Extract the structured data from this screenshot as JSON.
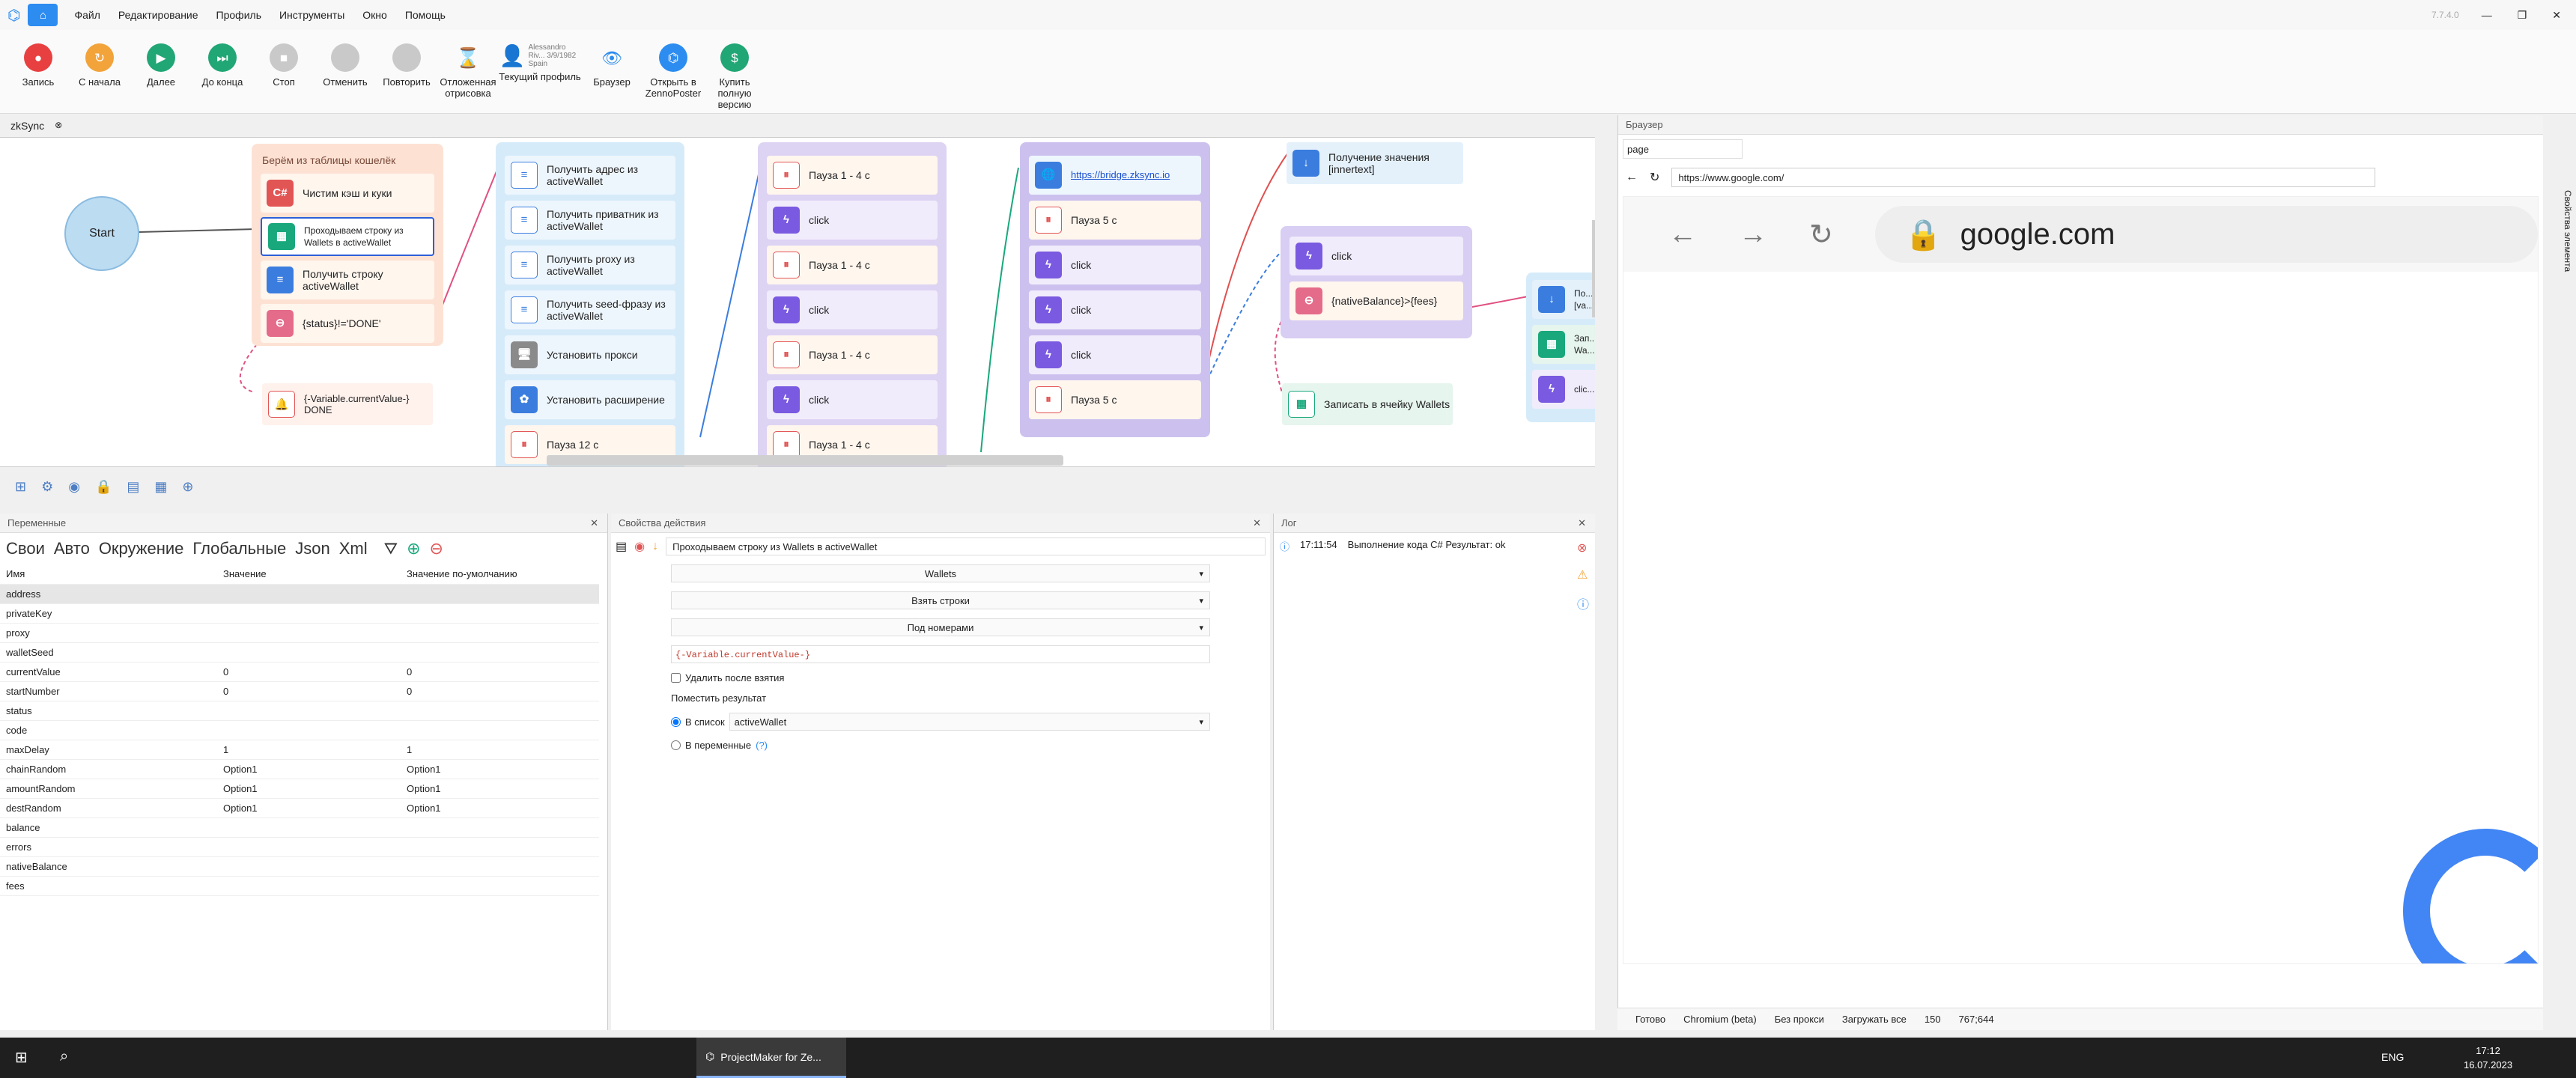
{
  "menu": {
    "items": [
      "Файл",
      "Редактирование",
      "Профиль",
      "Инструменты",
      "Окно",
      "Помощь"
    ],
    "version": "7.7.4.0"
  },
  "toolbar": {
    "buttons": [
      {
        "label": "Запись",
        "color": "#e84040"
      },
      {
        "label": "С начала",
        "color": "#f2a33a"
      },
      {
        "label": "Далее",
        "color": "#21a675"
      },
      {
        "label": "До конца",
        "color": "#21a675"
      },
      {
        "label": "Стоп",
        "color": ""
      },
      {
        "label": "Отменить",
        "color": ""
      },
      {
        "label": "Повторить",
        "color": ""
      },
      {
        "label": "Отложенная отрисовка",
        "color": ""
      },
      {
        "label": "Текущий профиль",
        "color": ""
      },
      {
        "label": "Браузер",
        "color": ""
      },
      {
        "label": "Открыть в ZennoPoster",
        "color": "#2d8cf0"
      },
      {
        "label": "Купить полную версию",
        "color": "#21a675"
      }
    ],
    "profile_text": "Alessandro Riv... 3/9/1982 Spain"
  },
  "project_tab": "zkSync",
  "canvas": {
    "start": "Start",
    "group1": {
      "title": "Берём из таблицы кошелёк",
      "nodes": [
        "Чистим кэш и куки",
        "Проходываем строку из Wallets в activeWallet",
        "Получить строку activeWallet",
        "{status}!='DONE'"
      ]
    },
    "floating": "{-Variable.currentValue-} DONE",
    "group2": {
      "nodes": [
        "Получить адрес из activeWallet",
        "Получить приватник из activeWallet",
        "Получить proxy из activeWallet",
        "Получить seed-фразу из activeWallet",
        "Установить прокси",
        "Установить расширение",
        "Пауза 12 с"
      ]
    },
    "group3": {
      "nodes": [
        "Пауза 1 - 4 с",
        "click",
        "Пауза 1 - 4 с",
        "click",
        "Пауза 1 - 4 с",
        "click",
        "Пауза 1 - 4 с"
      ]
    },
    "group4": {
      "nodes": [
        "https://bridge.zksync.io",
        "Пауза 5 с",
        "click",
        "click",
        "click",
        "Пауза 5 с"
      ]
    },
    "inner": "Получение значения [innertext]",
    "group5": {
      "nodes": [
        "click",
        "{nativeBalance}>{fees}"
      ]
    },
    "write": "Записать в ячейку Wallets",
    "group6": {
      "nodes": [
        "По... [va...",
        "Зап... Wa...",
        "clic..."
      ]
    }
  },
  "variables": {
    "title": "Переменные",
    "tabs": [
      "Свои",
      "Авто",
      "Окружение",
      "Глобальные",
      "Json",
      "Xml"
    ],
    "columns": [
      "Имя",
      "Значение",
      "Значение по-умолчанию"
    ],
    "rows": [
      [
        "address",
        "",
        ""
      ],
      [
        "privateKey",
        "",
        ""
      ],
      [
        "proxy",
        "",
        ""
      ],
      [
        "walletSeed",
        "",
        ""
      ],
      [
        "currentValue",
        "0",
        "0"
      ],
      [
        "startNumber",
        "0",
        "0"
      ],
      [
        "status",
        "",
        ""
      ],
      [
        "code",
        "",
        ""
      ],
      [
        "maxDelay",
        "1",
        "1"
      ],
      [
        "chainRandom",
        "Option1",
        "Option1"
      ],
      [
        "amountRandom",
        "Option1",
        "Option1"
      ],
      [
        "destRandom",
        "Option1",
        "Option1"
      ],
      [
        "balance",
        "",
        ""
      ],
      [
        "errors",
        "",
        ""
      ],
      [
        "nativeBalance",
        "",
        ""
      ],
      [
        "fees",
        "",
        ""
      ]
    ]
  },
  "props": {
    "title": "Свойства действия",
    "name": "Проходываем строку из Wallets в activeWallet",
    "table": "Wallets",
    "mode": "Взять строки",
    "by": "Под номерами",
    "expr": "{-Variable.currentValue-}",
    "delete_after": "Удалить после взятия",
    "put_result": "Поместить результат",
    "to_list": "В список",
    "list_value": "activeWallet",
    "to_vars": "В переменные",
    "help": "(?)"
  },
  "log": {
    "title": "Лог",
    "entries": [
      {
        "time": "17:11:54",
        "text": "Выполнение кода C# Результат: ok"
      }
    ]
  },
  "browser": {
    "title": "Браузер",
    "tab": "page",
    "url": "https://www.google.com/",
    "inner_domain": "google.com",
    "side_label": "Свойства элемента"
  },
  "status": {
    "ready": "Готово",
    "engine": "Chromium (beta)",
    "proxy": "Без прокси",
    "load": "Загружать все",
    "count": "150",
    "coords": "767;644"
  },
  "taskbar": {
    "app": "ProjectMaker for Ze...",
    "lang": "ENG",
    "time": "17:12",
    "date": "16.07.2023"
  }
}
